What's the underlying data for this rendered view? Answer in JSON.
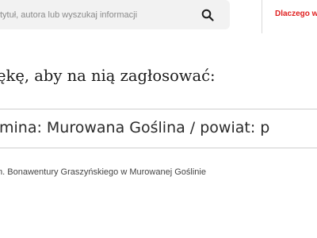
{
  "header": {
    "search": {
      "placeholder": "tytuł, autora lub wyszukaj informacji",
      "icon": "search-icon"
    },
    "why_link_label": "Dlaczego w"
  },
  "main": {
    "heading": "ękę, aby na nią zagłosować:",
    "location_select": {
      "selected_value": "mina: Murowana Goślina / powiat: p"
    },
    "library_name": "m. Bonawentury Graszyńskiego w Murowanej Goślinie"
  },
  "colors": {
    "accent": "#e02020",
    "search_background": "#f2f2f2",
    "text": "#1a1a1a"
  }
}
